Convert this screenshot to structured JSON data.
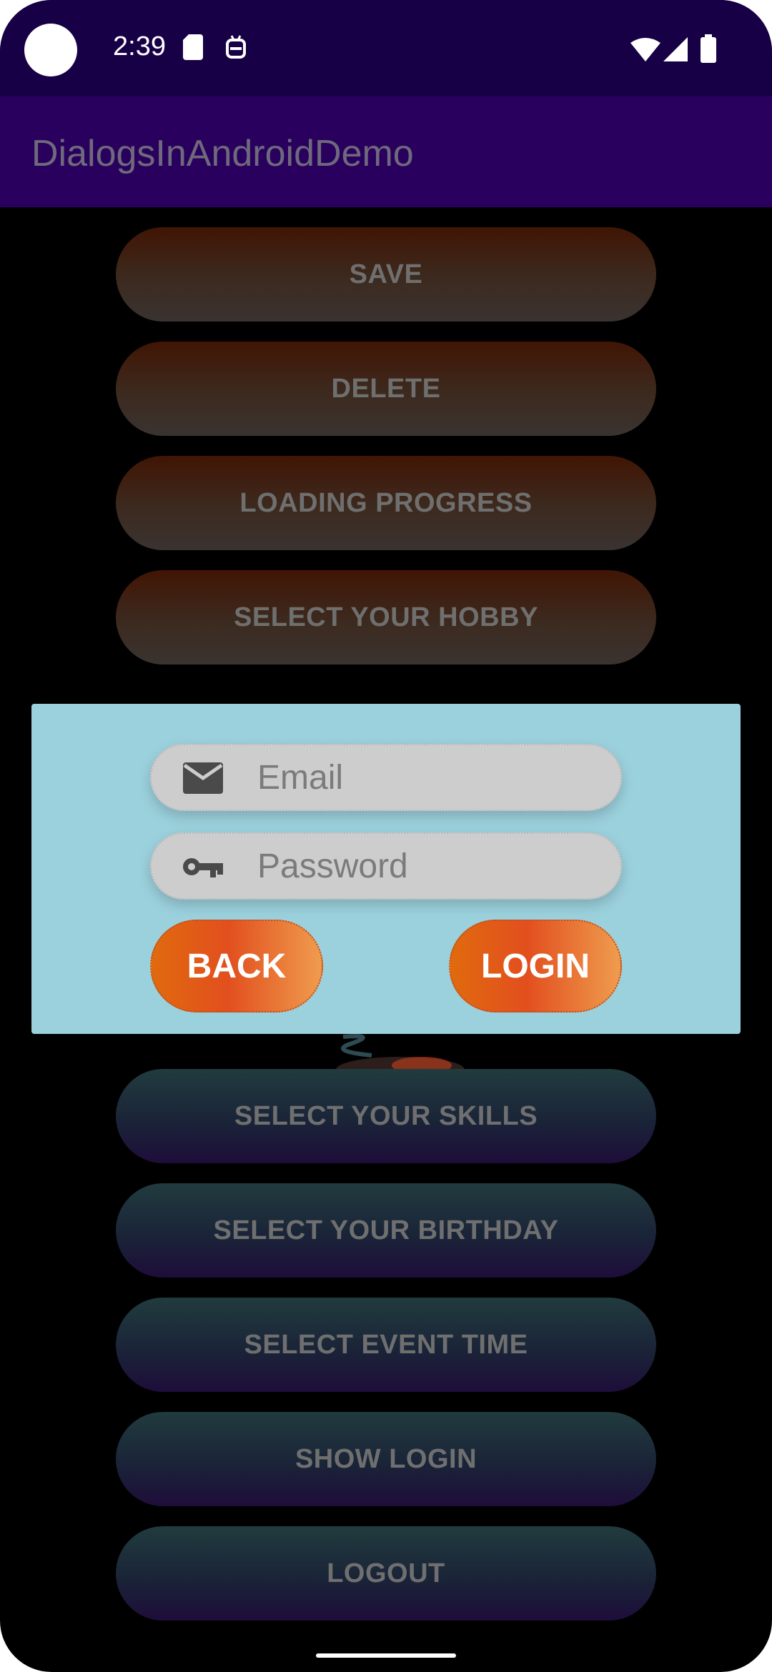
{
  "status_bar": {
    "time": "2:39",
    "icons": [
      "sd-card-icon",
      "debug-robot-icon",
      "wifi-icon",
      "cellular-signal-icon",
      "battery-icon"
    ]
  },
  "app_bar": {
    "title": "DialogsInAndroidDemo"
  },
  "menu_top": [
    {
      "label": "SAVE"
    },
    {
      "label": "DELETE"
    },
    {
      "label": "LOADING PROGRESS"
    },
    {
      "label": "SELECT YOUR HOBBY"
    }
  ],
  "menu_bottom": [
    {
      "label": "SELECT YOUR SKILLS"
    },
    {
      "label": "SELECT YOUR BIRTHDAY"
    },
    {
      "label": "SELECT EVENT TIME"
    },
    {
      "label": "SHOW LOGIN"
    },
    {
      "label": "LOGOUT"
    }
  ],
  "login_dialog": {
    "email": {
      "value": "",
      "placeholder": "Email",
      "icon": "mail-icon"
    },
    "password": {
      "value": "",
      "placeholder": "Password",
      "icon": "key-icon"
    },
    "back_label": "BACK",
    "login_label": "LOGIN"
  },
  "colors": {
    "status_bar_bg": "#180046",
    "app_bar_bg": "#2a005e",
    "dialog_bg": "#9bd1dd",
    "button_label": "#6f6f6f",
    "accent_orange": "#e24f1e"
  }
}
